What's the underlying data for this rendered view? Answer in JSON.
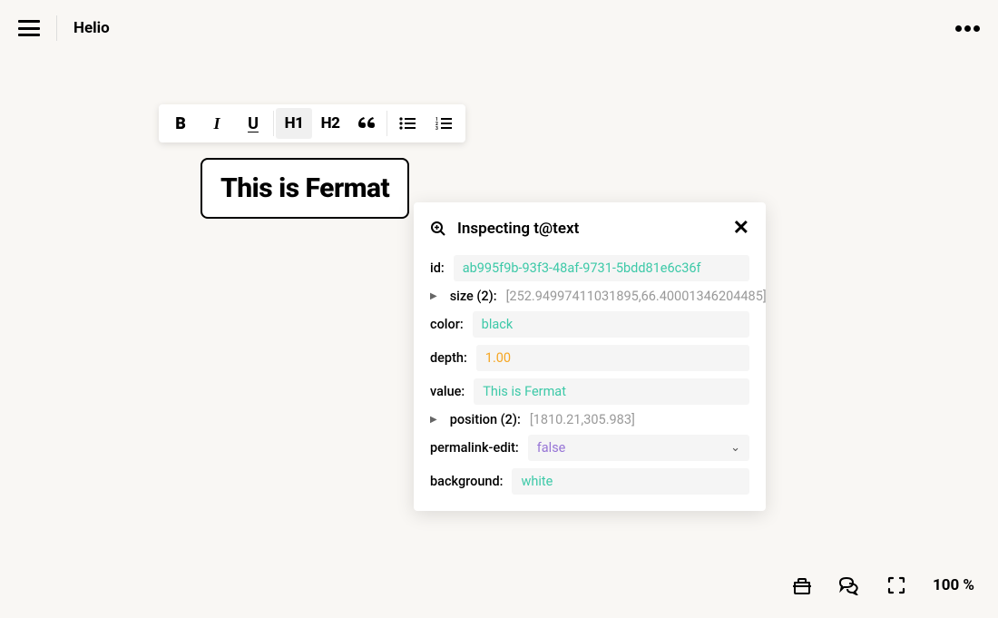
{
  "header": {
    "title": "Helio"
  },
  "toolbar": {
    "bold": "B",
    "italic": "I",
    "underline": "U",
    "h1": "H1",
    "h2": "H2"
  },
  "textCard": {
    "text": "This is Fermat"
  },
  "inspector": {
    "title": "Inspecting t@text",
    "props": {
      "id_label": "id:",
      "id_value": "ab995f9b-93f3-48af-9731-5bdd81e6c36f",
      "size_label": "size (2):",
      "size_value": "[252.94997411031895,66.40001346204485]",
      "color_label": "color:",
      "color_value": "black",
      "depth_label": "depth:",
      "depth_value": "1.00",
      "value_label": "value:",
      "value_value": "This is Fermat",
      "position_label": "position (2):",
      "position_value": "[1810.21,305.983]",
      "permalink_label": "permalink-edit:",
      "permalink_value": "false",
      "background_label": "background:",
      "background_value": "white"
    }
  },
  "bottomBar": {
    "zoom": "100 %"
  }
}
